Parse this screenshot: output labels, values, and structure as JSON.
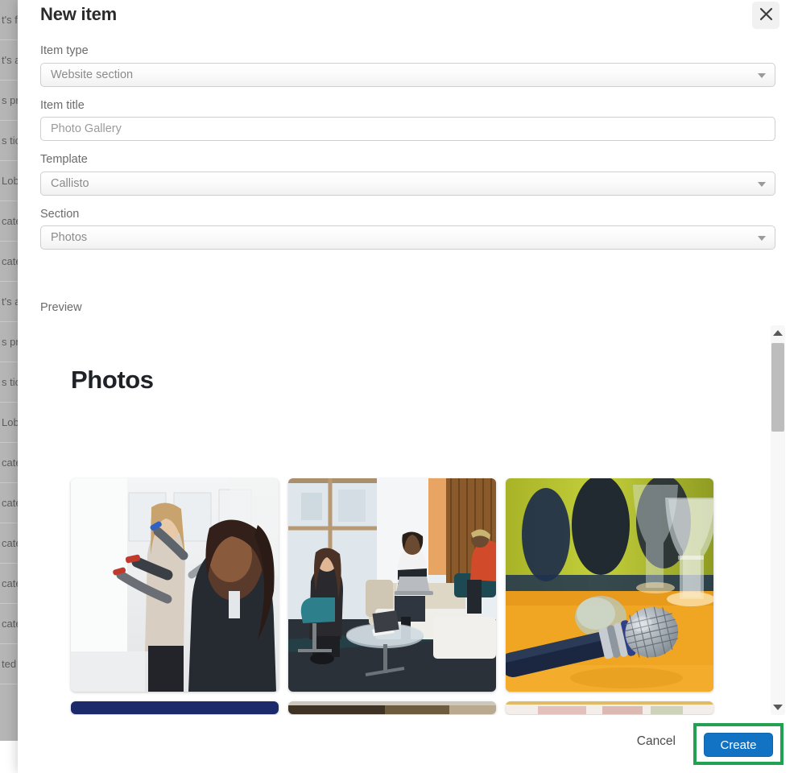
{
  "background": {
    "rows_left": [
      "t's f",
      "t's a",
      "s pr",
      "s tic",
      "Lob",
      "cate",
      "cate",
      "t's a",
      "s pr",
      "s tic",
      "Lob",
      "cate",
      "cate",
      "cate",
      "cate",
      "cate",
      "ted"
    ],
    "rows_right": [
      "",
      "",
      "",
      "",
      "",
      "",
      "",
      "",
      "",
      "",
      "",
      "",
      "",
      "",
      "",
      "",
      ""
    ]
  },
  "modal": {
    "title": "New item",
    "close_icon": "close-icon",
    "fields": {
      "item_type": {
        "label": "Item type",
        "value": "Website section",
        "caret_icon": "chevron-down-icon"
      },
      "item_title": {
        "label": "Item title",
        "value": "",
        "placeholder": "Photo Gallery"
      },
      "template": {
        "label": "Template",
        "value": "Callisto",
        "caret_icon": "chevron-down-icon"
      },
      "section": {
        "label": "Section",
        "value": "Photos",
        "caret_icon": "chevron-down-icon"
      }
    },
    "preview": {
      "label": "Preview",
      "heading": "Photos",
      "photos": [
        {
          "alt": "Two women writing on a whiteboard in a bright office"
        },
        {
          "alt": "People seated with laptops in a sunlit lounge area"
        },
        {
          "alt": "Microphone resting on an orange table beside wine glasses"
        },
        {
          "alt": "Dark blue banner image"
        },
        {
          "alt": "Brown and dark toned photo"
        },
        {
          "alt": "Light pink toned photo"
        }
      ]
    },
    "scrollbar": {
      "up_icon": "triangle-up-icon",
      "down_icon": "triangle-down-icon"
    },
    "footer": {
      "cancel_label": "Cancel",
      "create_label": "Create"
    }
  },
  "colors": {
    "accent_blue": "#1273c4",
    "highlight_green": "#22a152",
    "overlay_gray": "#b5b5b5",
    "label_gray": "#6b6b6b"
  }
}
